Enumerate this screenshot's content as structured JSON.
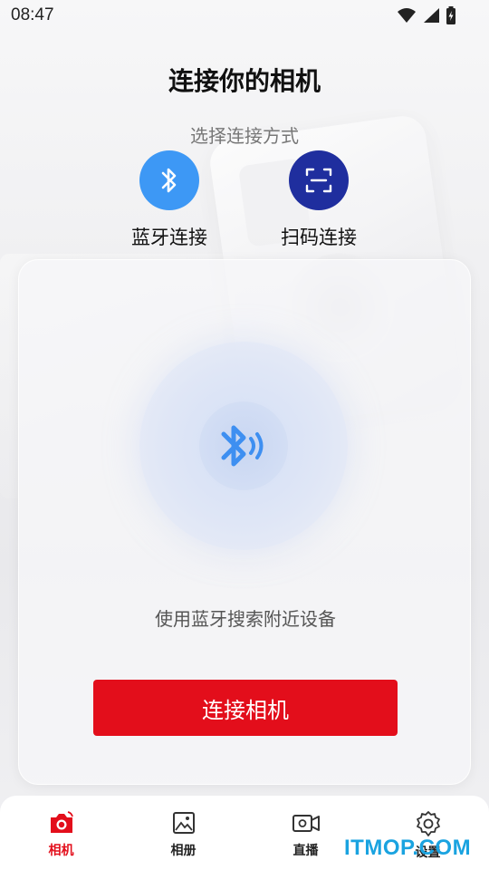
{
  "status_bar": {
    "time": "08:47"
  },
  "page": {
    "title": "连接你的相机",
    "subtitle": "选择连接方式"
  },
  "methods": [
    {
      "label": "蓝牙连接",
      "icon": "bluetooth-icon",
      "color": "#3d98f5"
    },
    {
      "label": "扫码连接",
      "icon": "scan-code-icon",
      "color": "#1f2e9e"
    }
  ],
  "card": {
    "hint": "使用蓝牙搜索附近设备",
    "connect_button": "连接相机"
  },
  "tabbar": {
    "items": [
      {
        "label": "相机",
        "icon": "camera-icon",
        "active": true
      },
      {
        "label": "相册",
        "icon": "album-icon",
        "active": false
      },
      {
        "label": "直播",
        "icon": "live-video-icon",
        "active": false
      },
      {
        "label": "设置",
        "icon": "gear-icon",
        "active": false
      }
    ]
  },
  "watermark": "ITMOP.COM",
  "colors": {
    "accent": "#e30e1b",
    "bluetooth": "#3d98f5",
    "scan": "#1f2e9e"
  }
}
